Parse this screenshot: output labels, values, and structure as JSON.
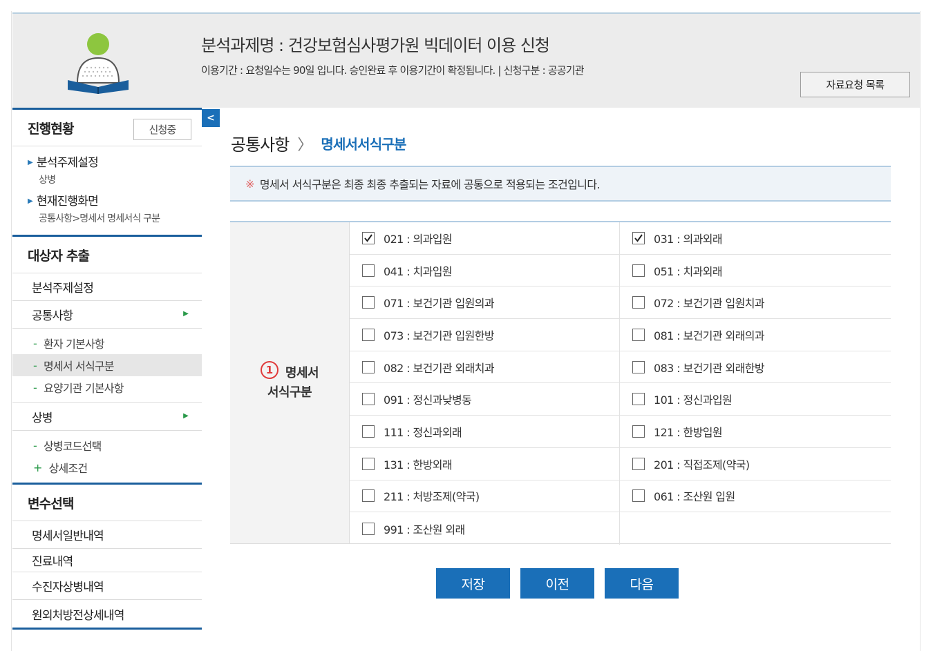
{
  "header": {
    "title": "분석과제명 : 건강보험심사평가원 빅데이터 이용 신청",
    "subtitle": "이용기간 : 요청일수는 90일 입니다. 승인완료 후 이용기간이 확정됩니다.  |  신청구분 : 공공기관",
    "list_button": "자료요청 목록"
  },
  "sidebar": {
    "progress": {
      "heading": "진행현황",
      "badge": "신청중",
      "items": [
        {
          "label": "분석주제설정",
          "sub": "상병"
        },
        {
          "label": "현재진행화면",
          "sub": "공통사항>명세서 명세서식 구분"
        }
      ]
    },
    "extract": {
      "heading": "대상자 추출",
      "item_topic": "분석주제설정",
      "item_common": "공통사항",
      "common_subs": [
        "환자 기본사항",
        "명세서 서식구분",
        "요양기관 기본사항"
      ],
      "item_disease": "상병",
      "disease_subs": [
        "상병코드선택",
        "상세조건"
      ]
    },
    "variables": {
      "heading": "변수선택",
      "items": [
        "명세서일반내역",
        "진료내역",
        "수진자상병내역",
        "원외처방전상세내역"
      ]
    }
  },
  "main": {
    "breadcrumb_parent": "공통사항",
    "breadcrumb_current": "명세서서식구분",
    "notice_mark": "※",
    "notice": "명세서 서식구분은 최종 최종 추출되는 자료에 공통으로 적용되는 조건입니다.",
    "section_number": "1",
    "section_label_line1": "명세서",
    "section_label_line2": "서식구분",
    "options": [
      {
        "label": "021 : 의과입원",
        "checked": true
      },
      {
        "label": "031 : 의과외래",
        "checked": true
      },
      {
        "label": "041 : 치과입원",
        "checked": false
      },
      {
        "label": "051 : 치과외래",
        "checked": false
      },
      {
        "label": "071 : 보건기관 입원의과",
        "checked": false
      },
      {
        "label": "072 : 보건기관 입원치과",
        "checked": false
      },
      {
        "label": "073 : 보건기관 입원한방",
        "checked": false
      },
      {
        "label": "081 : 보건기관 외래의과",
        "checked": false
      },
      {
        "label": "082 : 보건기관 외래치과",
        "checked": false
      },
      {
        "label": "083 : 보건기관 외래한방",
        "checked": false
      },
      {
        "label": "091 : 정신과낮병동",
        "checked": false
      },
      {
        "label": "101 : 정신과입원",
        "checked": false
      },
      {
        "label": "111 : 정신과외래",
        "checked": false
      },
      {
        "label": "121 : 한방입원",
        "checked": false
      },
      {
        "label": "131 : 한방외래",
        "checked": false
      },
      {
        "label": "201 : 직접조제(약국)",
        "checked": false
      },
      {
        "label": "211 : 처방조제(약국)",
        "checked": false
      },
      {
        "label": "061 : 조산원 입원",
        "checked": false
      },
      {
        "label": "991 : 조산원 외래",
        "checked": false
      }
    ],
    "buttons": {
      "save": "저장",
      "prev": "이전",
      "next": "다음"
    }
  },
  "colors": {
    "accent": "#1a6fb8",
    "sidebar_rule": "#1a5e9c",
    "header_bg": "#ececec",
    "notice_bg": "#eef3f8",
    "marker_red": "#e03b3b"
  }
}
